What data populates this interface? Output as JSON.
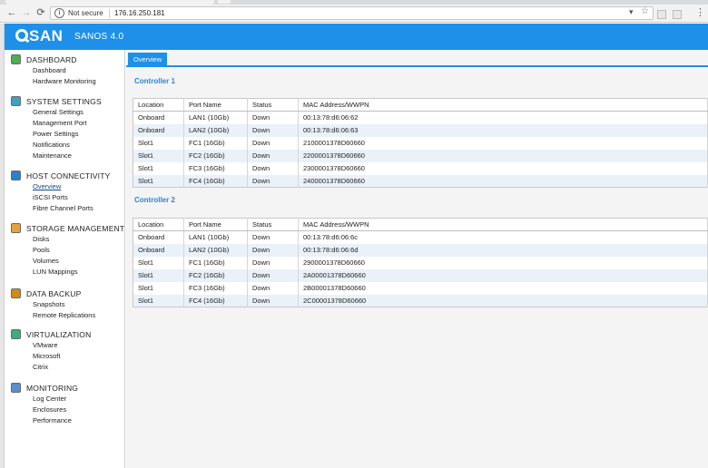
{
  "browser": {
    "secure_label": "Not secure",
    "url": "176.16.250.181",
    "back_glyph": "←",
    "forward_glyph": "→",
    "reload_glyph": "⟳",
    "star_glyph": "☆",
    "filter_glyph": "▾",
    "menu_glyph": "⋮",
    "info_glyph": "i"
  },
  "app": {
    "brand": "SAN",
    "brand_prefix_icon": "q-logo-icon",
    "version": "SANOS 4.0",
    "accent": "#1e90e9"
  },
  "sidebar": {
    "sections": [
      {
        "title": "DASHBOARD",
        "icon": "dashboard-icon",
        "icon_color": "#4caf50",
        "items": [
          "Dashboard",
          "Hardware Monitoring"
        ]
      },
      {
        "title": "SYSTEM SETTINGS",
        "icon": "system-settings-icon",
        "icon_color": "#3aa0c8",
        "items": [
          "General Settings",
          "Management Port",
          "Power Settings",
          "Notifications",
          "Maintenance"
        ]
      },
      {
        "title": "HOST CONNECTIVITY",
        "icon": "host-connectivity-icon",
        "icon_color": "#2d7fd0",
        "items": [
          "Overview",
          "iSCSI Ports",
          "Fibre Channel Ports"
        ],
        "active_item": "Overview"
      },
      {
        "title": "STORAGE MANAGEMENT",
        "icon": "storage-management-icon",
        "icon_color": "#e5a23a",
        "items": [
          "Disks",
          "Pools",
          "Volumes",
          "LUN Mappings"
        ]
      },
      {
        "title": "DATA BACKUP",
        "icon": "data-backup-icon",
        "icon_color": "#d08a1a",
        "items": [
          "Snapshots",
          "Remote Replications"
        ]
      },
      {
        "title": "VIRTUALIZATION",
        "icon": "virtualization-icon",
        "icon_color": "#3ab07a",
        "items": [
          "VMware",
          "Microsoft",
          "Citrix"
        ]
      },
      {
        "title": "MONITORING",
        "icon": "monitoring-icon",
        "icon_color": "#5a8fd0",
        "items": [
          "Log Center",
          "Enclosures",
          "Performance"
        ]
      }
    ]
  },
  "main": {
    "tab_label": "Overview",
    "columns": [
      "Location",
      "Port Name",
      "Status",
      "MAC Address/WWPN"
    ],
    "controllers": [
      {
        "title": "Controller 1",
        "rows": [
          [
            "Onboard",
            "LAN1 (10Gb)",
            "Down",
            "00:13:78:d6:06:62"
          ],
          [
            "Onboard",
            "LAN2 (10Gb)",
            "Down",
            "00:13:78:d6:06:63"
          ],
          [
            "Slot1",
            "FC1 (16Gb)",
            "Down",
            "2100001378D60660"
          ],
          [
            "Slot1",
            "FC2 (16Gb)",
            "Down",
            "2200001378D60660"
          ],
          [
            "Slot1",
            "FC3 (16Gb)",
            "Down",
            "2300001378D60660"
          ],
          [
            "Slot1",
            "FC4 (16Gb)",
            "Down",
            "2400001378D60660"
          ]
        ]
      },
      {
        "title": "Controller 2",
        "rows": [
          [
            "Onboard",
            "LAN1 (10Gb)",
            "Down",
            "00:13:78:d6:06:6c"
          ],
          [
            "Onboard",
            "LAN2 (10Gb)",
            "Down",
            "00:13:78:d6:06:6d"
          ],
          [
            "Slot1",
            "FC1 (16Gb)",
            "Down",
            "2900001378D60660"
          ],
          [
            "Slot1",
            "FC2 (16Gb)",
            "Down",
            "2A00001378D60660"
          ],
          [
            "Slot1",
            "FC3 (16Gb)",
            "Down",
            "2B00001378D60660"
          ],
          [
            "Slot1",
            "FC4 (16Gb)",
            "Down",
            "2C00001378D60660"
          ]
        ]
      }
    ]
  }
}
